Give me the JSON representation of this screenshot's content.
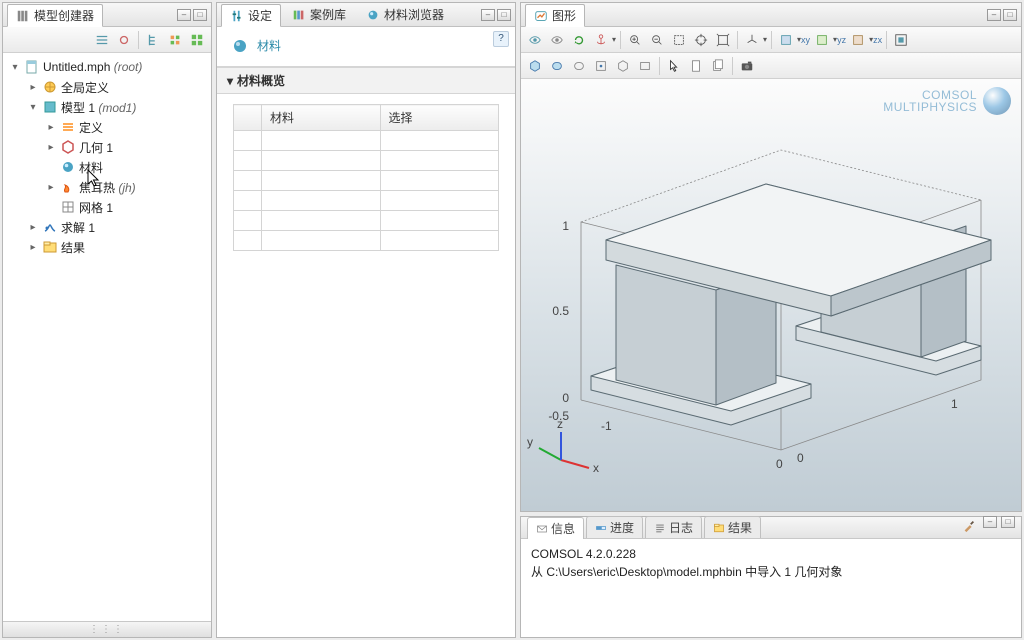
{
  "tree_panel": {
    "title": "模型创建器",
    "toolbar_icons": [
      "tree-expand-icon",
      "tree-collapse-icon",
      "tree-branch-icon",
      "tree-sort-icon",
      "tree-group-icon"
    ],
    "nodes": [
      {
        "depth": 0,
        "expander": "▾",
        "icon": "doc",
        "label": "Untitled.mph",
        "annot": "(root)"
      },
      {
        "depth": 1,
        "expander": "▸",
        "icon": "globe",
        "label": "全局定义",
        "annot": ""
      },
      {
        "depth": 1,
        "expander": "▾",
        "icon": "model",
        "label": "模型 1",
        "annot": "(mod1)"
      },
      {
        "depth": 2,
        "expander": "▸",
        "icon": "defs",
        "label": "定义",
        "annot": ""
      },
      {
        "depth": 2,
        "expander": "▸",
        "icon": "geom",
        "label": "几何 1",
        "annot": ""
      },
      {
        "depth": 2,
        "expander": "",
        "icon": "mat",
        "label": "材料",
        "annot": ""
      },
      {
        "depth": 2,
        "expander": "▸",
        "icon": "heat",
        "label": "焦耳热",
        "annot": "(jh)"
      },
      {
        "depth": 2,
        "expander": "",
        "icon": "mesh",
        "label": "网格 1",
        "annot": ""
      },
      {
        "depth": 1,
        "expander": "▸",
        "icon": "study",
        "label": "求解 1",
        "annot": ""
      },
      {
        "depth": 1,
        "expander": "▸",
        "icon": "results",
        "label": "结果",
        "annot": ""
      }
    ]
  },
  "settings_panel": {
    "tabs": [
      {
        "icon": "settings",
        "label": "设定",
        "active": true
      },
      {
        "icon": "library",
        "label": "案例库",
        "active": false
      },
      {
        "icon": "matbrowser",
        "label": "材料浏览器",
        "active": false
      }
    ],
    "header_icon": "mat",
    "header_title": "材料",
    "section_title": "材料概览",
    "table": {
      "col1": "材料",
      "col2": "选择",
      "empty_rows": 6
    }
  },
  "graphics_panel": {
    "title": "图形",
    "toolbar1_groups": [
      [
        "eye-arrow",
        "eye",
        "refresh",
        "anchor"
      ],
      [
        "zoom-in",
        "zoom-out",
        "zoom-box",
        "zoom-center",
        "zoom-extents"
      ],
      [
        "axis-xyz"
      ],
      [
        "view-xy",
        "view-yz",
        "view-zx"
      ],
      [
        "fullscreen"
      ]
    ],
    "toolbar2_groups": [
      [
        "sel-dom",
        "sel-bnd",
        "sel-edge",
        "sel-point",
        "sel-cube",
        "sel-rect"
      ],
      [
        "cursor-arrow",
        "page",
        "pages"
      ],
      [
        "camera"
      ]
    ],
    "axis_ticks_z": [
      "1",
      "0.5",
      "0"
    ],
    "axis_ticks_x": [
      "-1",
      "-0.5",
      "0"
    ],
    "axis_ticks_y": [
      "0",
      "1"
    ],
    "axis_labels": {
      "x": "x",
      "y": "y",
      "z": "z"
    },
    "watermark_line1": "COMSOL",
    "watermark_line2": "MULTIPHYSICS"
  },
  "messages_panel": {
    "tabs": [
      {
        "icon": "mail",
        "label": "信息",
        "active": true
      },
      {
        "icon": "progress",
        "label": "进度",
        "active": false
      },
      {
        "icon": "log",
        "label": "日志",
        "active": false
      },
      {
        "icon": "results",
        "label": "结果",
        "active": false
      }
    ],
    "lines": [
      "COMSOL 4.2.0.228",
      "从 C:\\Users\\eric\\Desktop\\model.mphbin 中导入 1 几何对象"
    ]
  }
}
